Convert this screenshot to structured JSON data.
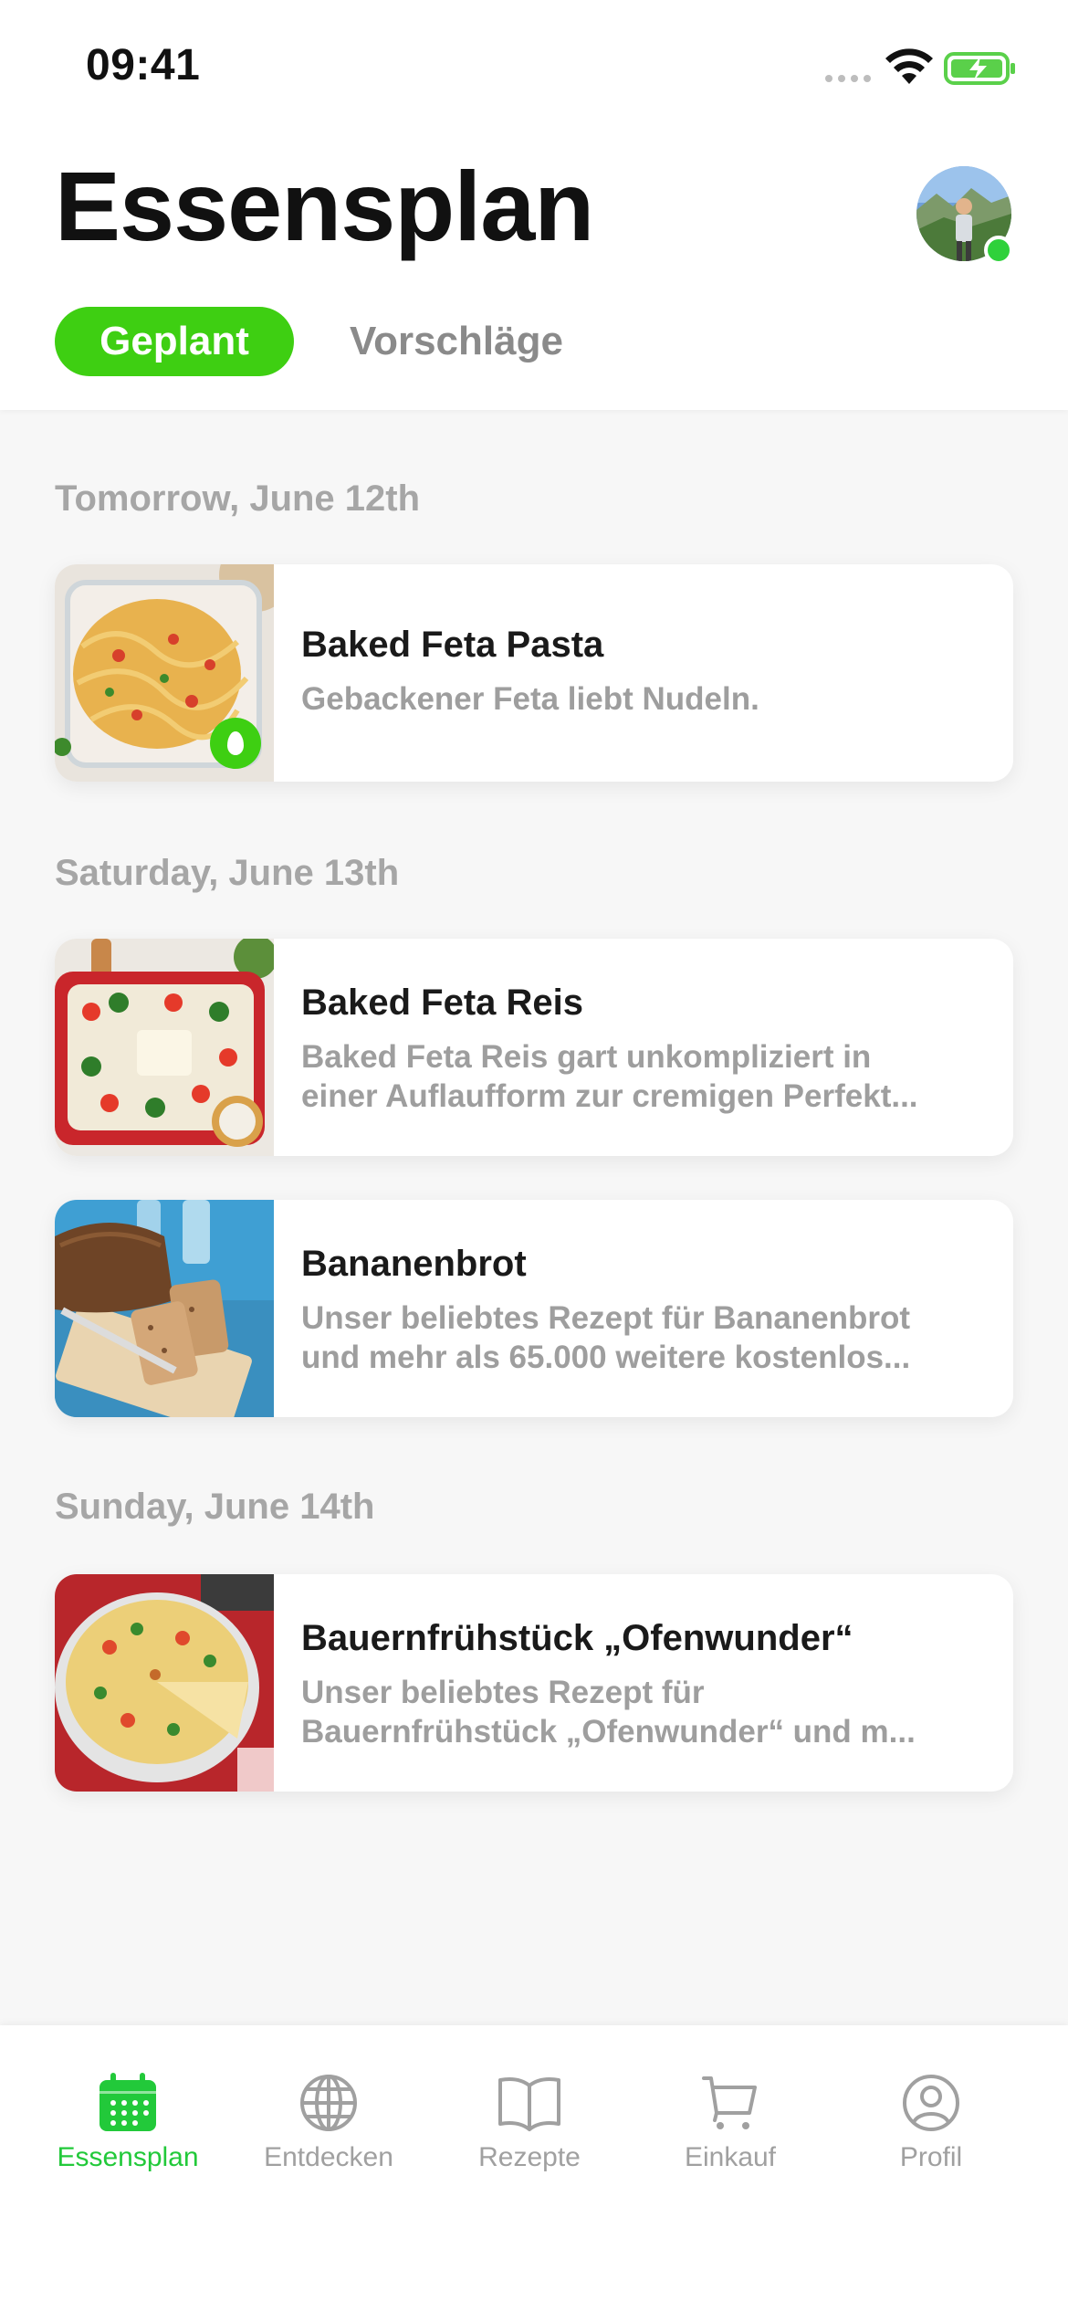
{
  "status_bar": {
    "time": "09:41"
  },
  "header": {
    "title": "Essensplan",
    "tabs": [
      {
        "label": "Geplant",
        "active": true
      },
      {
        "label": "Vorschläge",
        "active": false
      }
    ],
    "accent_color": "#3ecf12"
  },
  "days": [
    {
      "label": "Tomorrow, June 12th",
      "meals": [
        {
          "title": "Baked Feta Pasta",
          "description_lines": [
            "Gebackener Feta liebt Nudeln."
          ],
          "badge": "egg-icon"
        }
      ]
    },
    {
      "label": "Saturday, June 13th",
      "meals": [
        {
          "title": "Baked Feta Reis",
          "description_lines": [
            "Baked Feta Reis gart unkompliziert in",
            "einer Auflaufform zur cremigen Perfekt..."
          ]
        },
        {
          "title": "Bananenbrot",
          "description_lines": [
            "Unser beliebtes Rezept für Bananenbrot",
            "und mehr als 65.000 weitere kostenlos..."
          ]
        }
      ]
    },
    {
      "label": "Sunday, June 14th",
      "meals": [
        {
          "title": "Bauernfrühstück „Ofenwunder“",
          "description_lines": [
            "Unser beliebtes Rezept für",
            "Bauernfrühstück „Ofenwunder“ und m..."
          ]
        }
      ]
    }
  ],
  "tab_bar": {
    "items": [
      {
        "label": "Essensplan",
        "icon": "calendar-icon",
        "active": true
      },
      {
        "label": "Entdecken",
        "icon": "globe-icon",
        "active": false
      },
      {
        "label": "Rezepte",
        "icon": "book-icon",
        "active": false
      },
      {
        "label": "Einkauf",
        "icon": "cart-icon",
        "active": false
      },
      {
        "label": "Profil",
        "icon": "profile-icon",
        "active": false
      }
    ],
    "active_color": "#22c93a",
    "inactive_color": "#a0a0a0"
  }
}
